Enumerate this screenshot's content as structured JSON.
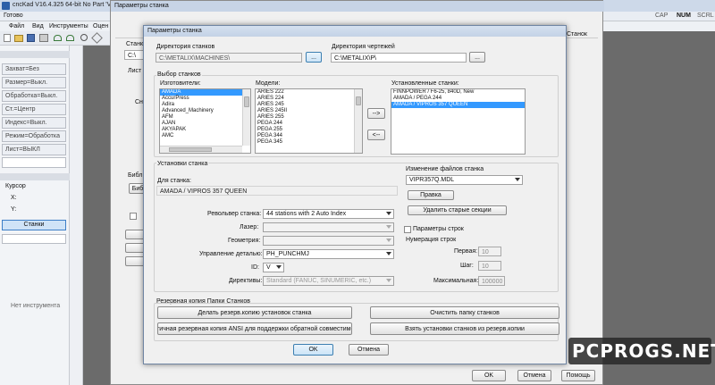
{
  "app": {
    "title": "cncKad V16.4.325 64-bit No Part 'V",
    "status": "Готово",
    "menu": [
      "Файл",
      "Вид",
      "Инструменты",
      "Оцен"
    ],
    "indicators": [
      "CAP",
      "NUM",
      "SCRL"
    ],
    "side_buttons": [
      "Захват=Без",
      "Размер=Выкл.",
      "Обработка=Выкл.",
      "Ст.=Центр",
      "Индекс=Выкл.",
      "Режим=Обработка",
      "Лист=ВЫКЛ"
    ],
    "cursor": {
      "label": "Курсор",
      "x": "X:",
      "y": "Y:"
    },
    "machines_button": "Станки",
    "no_tool": "Нет инструмента"
  },
  "back_dialog": {
    "title": "Параметры станка",
    "tab_right": "Станок",
    "label_stank": "Станк",
    "path": "C:\\",
    "label_list": "Лист",
    "label_sn": "Сн",
    "label_bibl": "Библ",
    "btn_bib": "Биб",
    "ok": "OK",
    "cancel": "Отмена",
    "help": "Помощь"
  },
  "dialog": {
    "title": "Параметры станка",
    "machines_dir_label": "Директория станков",
    "machines_dir": "C:\\METALIX\\MACHINES\\",
    "browse": "...",
    "drawings_dir_label": "Директория чертежей",
    "drawings_dir": "C:\\METALIX\\P\\",
    "select_group": "Выбор станков",
    "makers_label": "Изготовители:",
    "makers": [
      "AMADA",
      "AccurPress",
      "Adira",
      "Advanced_Machinery",
      "AFM",
      "AJAN",
      "AKYAPAK",
      "AMC"
    ],
    "makers_selected": 0,
    "models_label": "Модели:",
    "models": [
      "ARIES 222",
      "ARIES 224",
      "ARIES 245",
      "ARIES 245II",
      "ARIES 255",
      "PEGA 244",
      "PEGA 255",
      "PEGA 344",
      "PEGA 345"
    ],
    "add_btn": "-->",
    "remove_btn": "<--",
    "installed_label": "Установленные станки:",
    "installed": [
      "FINNPOWER / F6-25, 840D, New",
      "AMADA / PEGA 244",
      "AMADA / VIPROS 357 QUEEN"
    ],
    "installed_selected": 2,
    "settings_group": "Установки станка",
    "for_machine_label": "Для станка:",
    "for_machine": "AMADA / VIPROS 357 QUEEN",
    "turret_label": "Револьвер станка:",
    "turret": "44 stations with 2 Auto Index",
    "laser_label": "Лазер:",
    "geometry_label": "Геометрия:",
    "control_label": "Управление деталью:",
    "control": "PH_PUNCHMJ",
    "id_label": "ID:",
    "id": "V",
    "directives_label": "Директивы:",
    "directives": "Standard (FANUC, SINUMERIC, etc.)",
    "change_files_group": "Изменение файлов станка",
    "mdl_file": "VIPR357Q.MDL",
    "edit_btn": "Правка",
    "delete_old_btn": "Удалить старые секции",
    "line_params_label": "Параметры строк",
    "line_numbering_group": "Нумерация строк",
    "first_label": "Первая:",
    "first": "10",
    "step_label": "Шаг:",
    "step": "10",
    "max_label": "Максимальная:",
    "max": "100000",
    "backup_group": "Резервная копия Папки Станков",
    "backup_btn": "Делать резерв.копию установок станка",
    "clear_btn": "Очистить папку станков",
    "ansi_btn": "Частичная резервная копия ANSI для поддержки обратной совместимости",
    "restore_btn": "Взять установки станков из резерв.копии",
    "ok": "OK",
    "cancel": "Отмена"
  },
  "watermark": "PCPROGS.NET",
  "colors": {
    "titlebar": "#c9d6e8",
    "selection": "#3399ff",
    "dark_bg": "#5a5a5a"
  }
}
